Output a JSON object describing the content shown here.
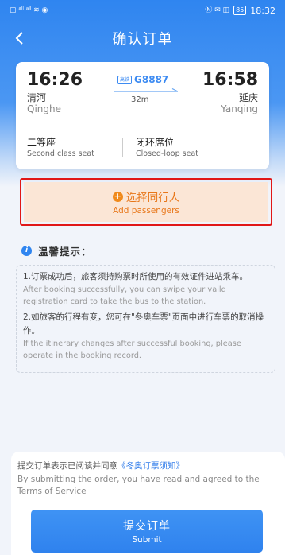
{
  "status_bar": {
    "left_icons": "▢ ᵃˡˡ ᵃˡˡ ≋ ◉",
    "right_icons": "Ⓝ ✉ ◫",
    "battery": "85",
    "time": "18:32"
  },
  "header": {
    "title": "确认订单"
  },
  "ticket": {
    "departure_time": "16:26",
    "departure_cn": "清河",
    "departure_en": "Qinghe",
    "train_badge": "高铁",
    "train_number": "G8887",
    "duration": "32m",
    "arrival_time": "16:58",
    "arrival_cn": "延庆",
    "arrival_en": "Yanqing",
    "seat_cn": "二等座",
    "seat_en": "Second class seat",
    "cabin_cn": "闭环席位",
    "cabin_en": "Closed-loop seat"
  },
  "add_passengers": {
    "label_cn": "选择同行人",
    "label_en": "Add passengers",
    "icon": "+"
  },
  "tips": {
    "title": "温馨提示：",
    "items": [
      {
        "cn": "1.订票成功后，旅客须持购票时所使用的有效证件进站乘车。",
        "en": "After booking successfully, you can swipe your vaild registration card to take the bus to the station."
      },
      {
        "cn": "2.如旅客的行程有变，您可在\"冬奥车票\"页面中进行车票的取消操作。",
        "en": "If the itinerary changes after successful booking, please operate in the booking record."
      }
    ]
  },
  "agreement": {
    "prefix_cn": "提交订单表示已阅读并同意",
    "link_cn": "《冬奥订票须知》",
    "text_en": "By submitting the order, you have read and agreed to the Terms of Service"
  },
  "submit": {
    "label_cn": "提交订单",
    "label_en": "Submit"
  },
  "colors": {
    "primary": "#2f85f0",
    "accent_orange": "#e8771a",
    "highlight_red": "#e11717"
  }
}
